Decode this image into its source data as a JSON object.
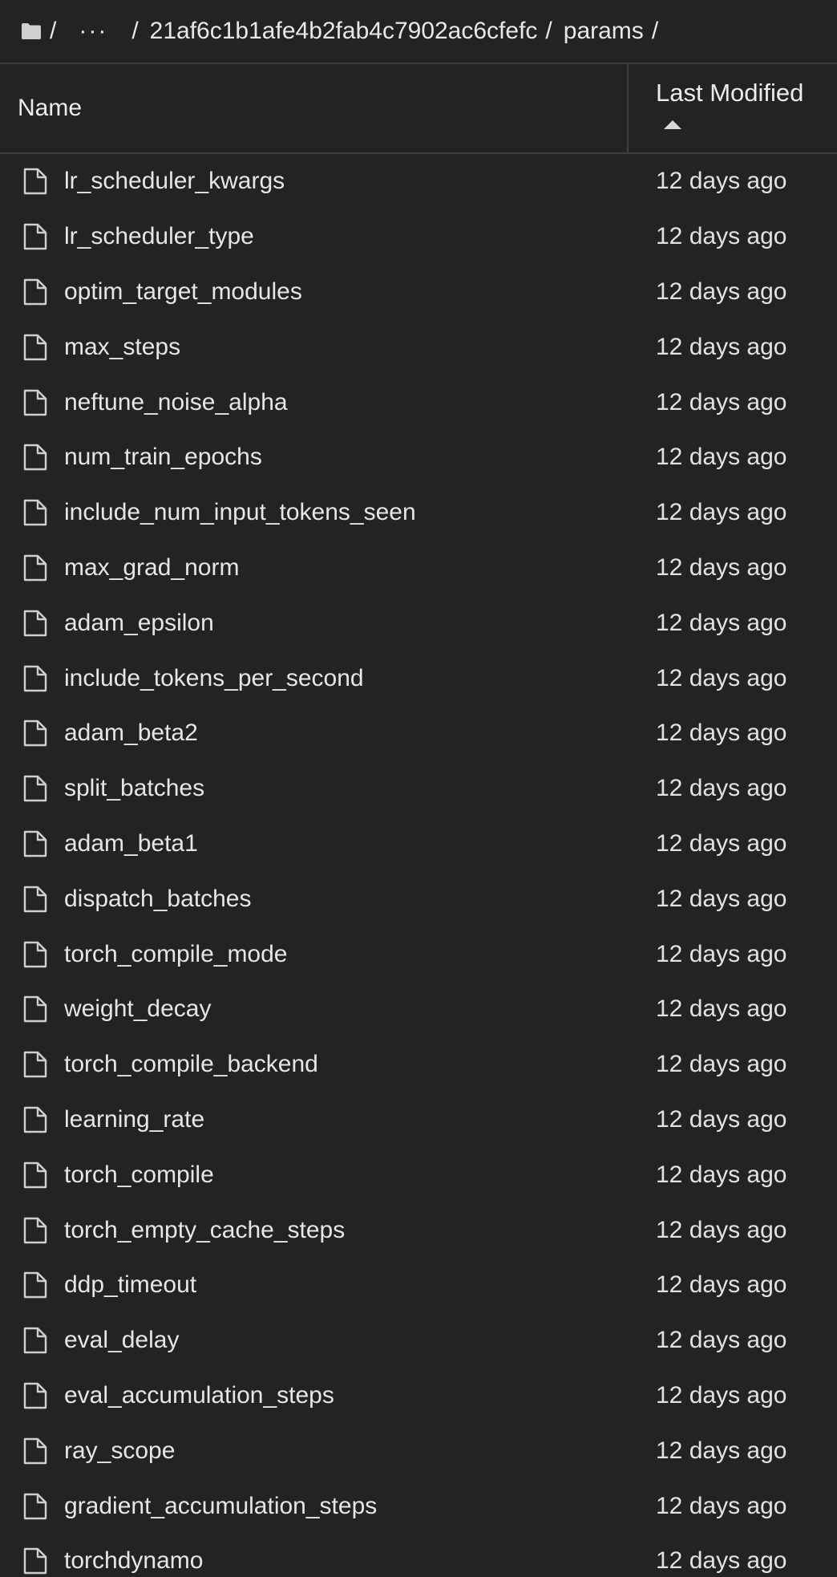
{
  "breadcrumb": {
    "root_sep": "/",
    "ellipsis": "···",
    "segments": [
      "21af6c1b1afe4b2fab4c7902ac6cfefc",
      "params"
    ],
    "sep": "/"
  },
  "table": {
    "col_name": "Name",
    "col_modified": "Last Modified",
    "sort": "ascending"
  },
  "files": [
    {
      "name": "lr_scheduler_kwargs",
      "modified": "12 days ago"
    },
    {
      "name": "lr_scheduler_type",
      "modified": "12 days ago"
    },
    {
      "name": "optim_target_modules",
      "modified": "12 days ago"
    },
    {
      "name": "max_steps",
      "modified": "12 days ago"
    },
    {
      "name": "neftune_noise_alpha",
      "modified": "12 days ago"
    },
    {
      "name": "num_train_epochs",
      "modified": "12 days ago"
    },
    {
      "name": "include_num_input_tokens_seen",
      "modified": "12 days ago"
    },
    {
      "name": "max_grad_norm",
      "modified": "12 days ago"
    },
    {
      "name": "adam_epsilon",
      "modified": "12 days ago"
    },
    {
      "name": "include_tokens_per_second",
      "modified": "12 days ago"
    },
    {
      "name": "adam_beta2",
      "modified": "12 days ago"
    },
    {
      "name": "split_batches",
      "modified": "12 days ago"
    },
    {
      "name": "adam_beta1",
      "modified": "12 days ago"
    },
    {
      "name": "dispatch_batches",
      "modified": "12 days ago"
    },
    {
      "name": "torch_compile_mode",
      "modified": "12 days ago"
    },
    {
      "name": "weight_decay",
      "modified": "12 days ago"
    },
    {
      "name": "torch_compile_backend",
      "modified": "12 days ago"
    },
    {
      "name": "learning_rate",
      "modified": "12 days ago"
    },
    {
      "name": "torch_compile",
      "modified": "12 days ago"
    },
    {
      "name": "torch_empty_cache_steps",
      "modified": "12 days ago"
    },
    {
      "name": "ddp_timeout",
      "modified": "12 days ago"
    },
    {
      "name": "eval_delay",
      "modified": "12 days ago"
    },
    {
      "name": "eval_accumulation_steps",
      "modified": "12 days ago"
    },
    {
      "name": "ray_scope",
      "modified": "12 days ago"
    },
    {
      "name": "gradient_accumulation_steps",
      "modified": "12 days ago"
    },
    {
      "name": "torchdynamo",
      "modified": "12 days ago"
    }
  ]
}
